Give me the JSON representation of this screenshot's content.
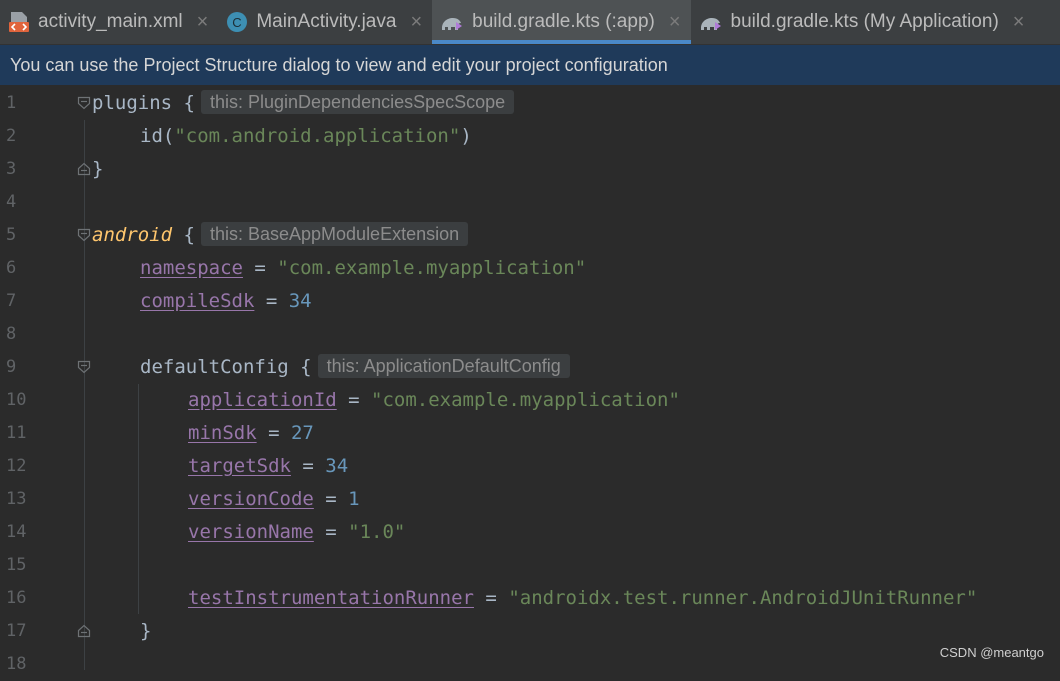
{
  "tabs": [
    {
      "label": "activity_main.xml",
      "icon": "xml-layout-icon",
      "active": false
    },
    {
      "label": "MainActivity.java",
      "icon": "java-class-icon",
      "active": false
    },
    {
      "label": "build.gradle.kts (:app)",
      "icon": "gradle-icon",
      "active": true
    },
    {
      "label": "build.gradle.kts (My Application)",
      "icon": "gradle-icon",
      "active": false
    }
  ],
  "close_glyph": "×",
  "class_icon_letter": "C",
  "banner": {
    "text": "You can use the Project Structure dialog to view and edit your project configuration"
  },
  "editor": {
    "line_numbers": [
      "1",
      "2",
      "3",
      "4",
      "5",
      "6",
      "7",
      "8",
      "9",
      "10",
      "11",
      "12",
      "13",
      "14",
      "15",
      "16",
      "17",
      "18"
    ],
    "lines": {
      "l1": {
        "plugins": "plugins",
        "brace": " {",
        "hint": "this: PluginDependenciesSpecScope"
      },
      "l2": {
        "call": "id(",
        "str": "\"com.android.application\"",
        "close": ")"
      },
      "l3": {
        "brace": "}"
      },
      "l5": {
        "android": "android",
        "brace": " {",
        "hint": "this: BaseAppModuleExtension"
      },
      "l6": {
        "prop": "namespace",
        "eq": " = ",
        "str": "\"com.example.myapplication\""
      },
      "l7": {
        "prop": "compileSdk",
        "eq": " = ",
        "num": "34"
      },
      "l9": {
        "name": "defaultConfig",
        "brace": " {",
        "hint": "this: ApplicationDefaultConfig"
      },
      "l10": {
        "prop": "applicationId",
        "eq": " = ",
        "str": "\"com.example.myapplication\""
      },
      "l11": {
        "prop": "minSdk",
        "eq": " = ",
        "num": "27"
      },
      "l12": {
        "prop": "targetSdk",
        "eq": " = ",
        "num": "34"
      },
      "l13": {
        "prop": "versionCode",
        "eq": " = ",
        "num": "1"
      },
      "l14": {
        "prop": "versionName",
        "eq": " = ",
        "str": "\"1.0\""
      },
      "l16": {
        "prop": "testInstrumentationRunner",
        "eq": " = ",
        "str": "\"androidx.test.runner.AndroidJUnitRunner\""
      },
      "l17": {
        "brace": "}"
      }
    }
  },
  "watermark": "CSDN @meantgo",
  "colors": {
    "background": "#2b2b2b",
    "banner": "#1f3a5a",
    "string": "#6a8759",
    "number": "#6897bb",
    "property": "#9876aa",
    "keyword": "#ffc66d",
    "active_tab_underline": "#4a88c7"
  }
}
